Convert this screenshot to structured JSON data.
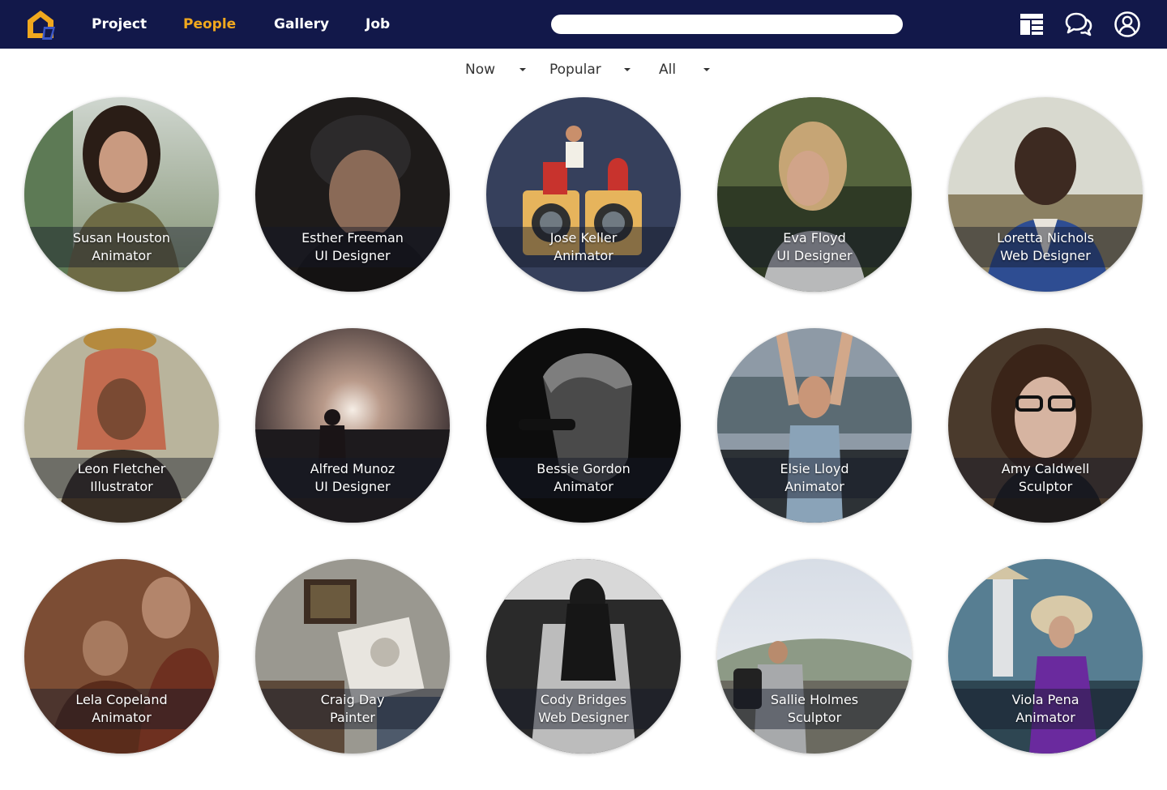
{
  "nav": {
    "logo_icon": "house-logo-icon",
    "links": [
      {
        "label": "Project",
        "active": false
      },
      {
        "label": "People",
        "active": true
      },
      {
        "label": "Gallery",
        "active": false
      },
      {
        "label": "Job",
        "active": false
      }
    ],
    "search_value": "",
    "search_placeholder": "",
    "icons": [
      "layout-icon",
      "chat-icon",
      "user-icon"
    ]
  },
  "colors": {
    "navbar_bg": "#12184a",
    "active_link": "#f0a81e",
    "logo_accent": "#f0a81e",
    "logo_secondary": "#3a57c7"
  },
  "filters": {
    "time": "Now",
    "sort": "Popular",
    "category": "All"
  },
  "people": [
    {
      "name": "Susan Houston",
      "role": "Animator"
    },
    {
      "name": "Esther Freeman",
      "role": "UI Designer"
    },
    {
      "name": "Jose Keller",
      "role": "Animator"
    },
    {
      "name": "Eva Floyd",
      "role": "UI Designer"
    },
    {
      "name": "Loretta Nichols",
      "role": "Web Designer"
    },
    {
      "name": "Leon Fletcher",
      "role": "Illustrator"
    },
    {
      "name": "Alfred Munoz",
      "role": "UI Designer"
    },
    {
      "name": "Bessie Gordon",
      "role": "Animator"
    },
    {
      "name": "Elsie Lloyd",
      "role": "Animator"
    },
    {
      "name": "Amy Caldwell",
      "role": "Sculptor"
    },
    {
      "name": "Lela Copeland",
      "role": "Animator"
    },
    {
      "name": "Craig Day",
      "role": "Painter"
    },
    {
      "name": "Cody Bridges",
      "role": "Web Designer"
    },
    {
      "name": "Sallie Holmes",
      "role": "Sculptor"
    },
    {
      "name": "Viola Pena",
      "role": "Animator"
    }
  ]
}
